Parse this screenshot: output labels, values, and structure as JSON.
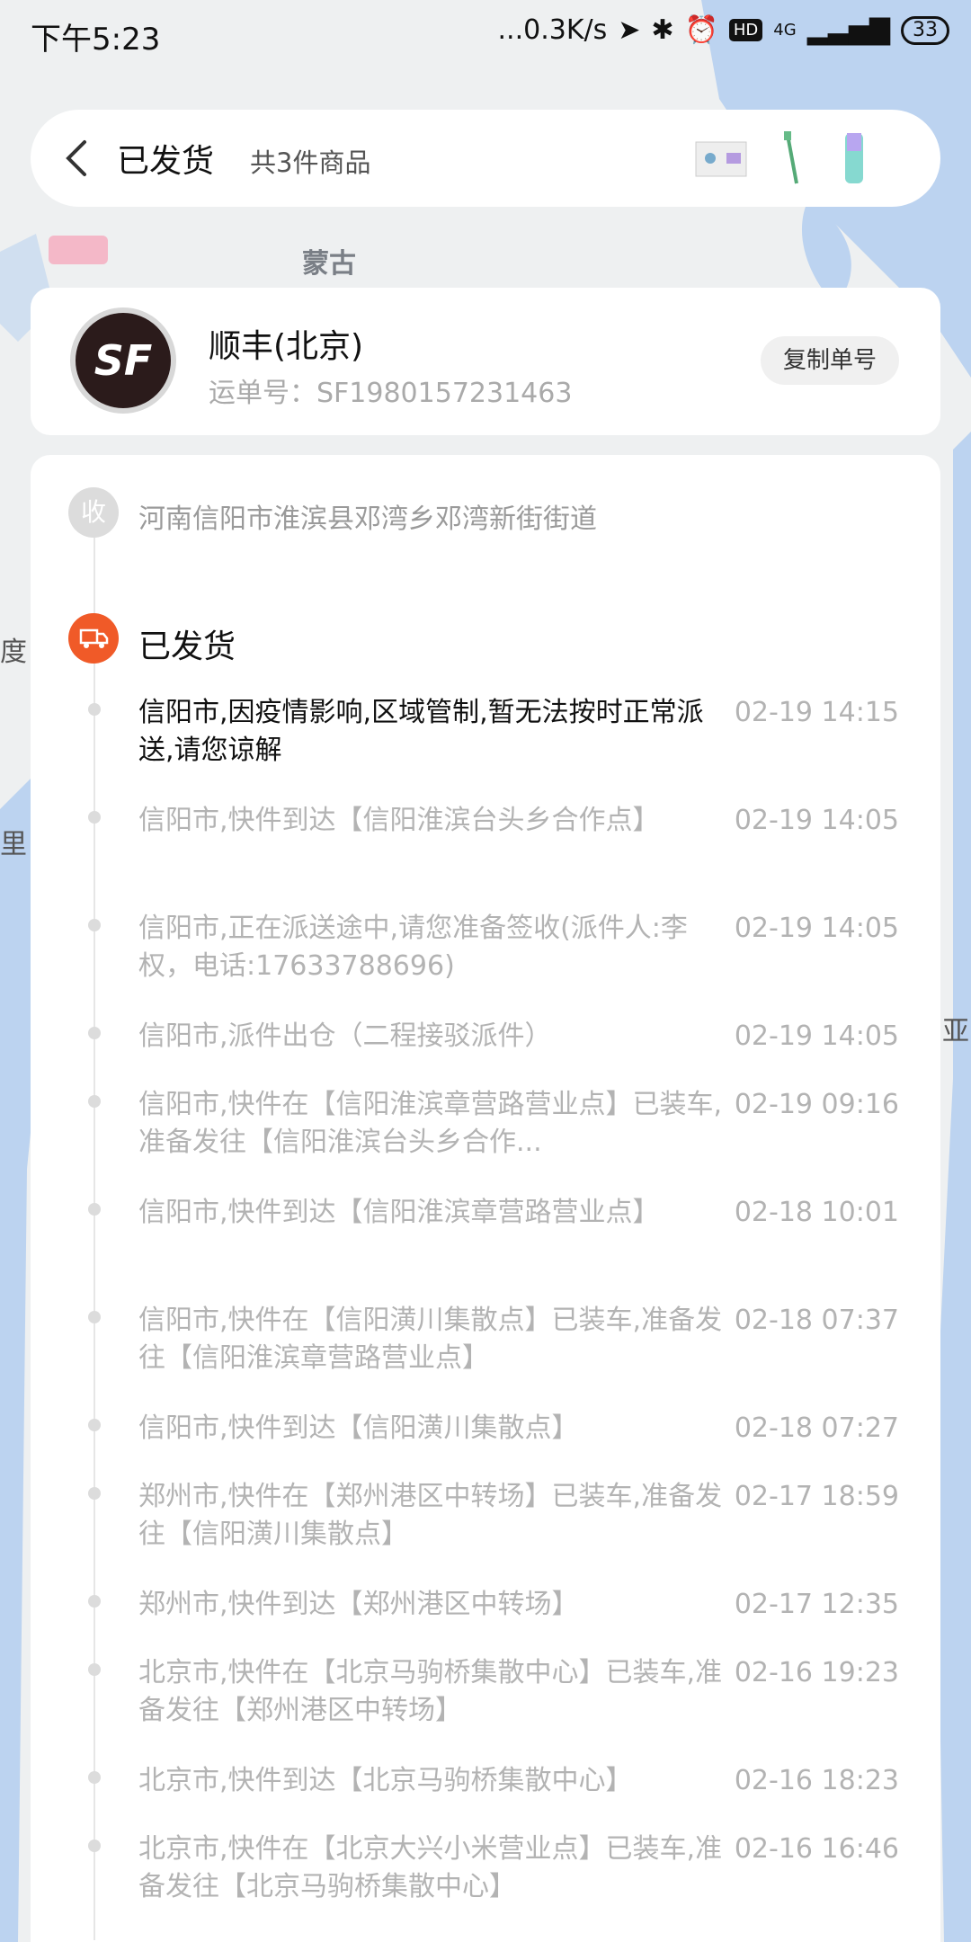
{
  "status_bar": {
    "time": "下午5:23",
    "network_speed": "...0.3K/s",
    "net_type": "4G",
    "hd": "HD",
    "battery": "33"
  },
  "map": {
    "labels": [
      "蒙古",
      "度",
      "亚",
      "里"
    ]
  },
  "header": {
    "title": "已发货",
    "item_count": "共3件商品"
  },
  "courier": {
    "name": "顺丰(北京)",
    "waybill": "运单号：SF1980157231463",
    "copy_label": "复制单号",
    "logo_text": "SF"
  },
  "timeline": {
    "receive_badge": "收",
    "receive_address": "河南信阳市淮滨县邓湾乡邓湾新街街道",
    "shipped_label": "已发货",
    "events": [
      {
        "text": "信阳市,因疫情影响,区域管制,暂无法按时正常派送,请您谅解",
        "time": "02-19 14:15"
      },
      {
        "text": "信阳市,快件到达【信阳淮滨台头乡合作点】",
        "time": "02-19 14:05"
      },
      {
        "text": "信阳市,正在派送途中,请您准备签收(派件人:李权，电话:17633788696)",
        "time": "02-19 14:05"
      },
      {
        "text": "信阳市,派件出仓（二程接驳派件）",
        "time": "02-19 14:05"
      },
      {
        "text": "信阳市,快件在【信阳淮滨章营路营业点】已装车,准备发往【信阳淮滨台头乡合作...",
        "time": "02-19 09:16"
      },
      {
        "text": "信阳市,快件到达【信阳淮滨章营路营业点】",
        "time": "02-18 10:01"
      },
      {
        "text": "信阳市,快件在【信阳潢川集散点】已装车,准备发往【信阳淮滨章营路营业点】",
        "time": "02-18 07:37"
      },
      {
        "text": "信阳市,快件到达【信阳潢川集散点】",
        "time": "02-18 07:27"
      },
      {
        "text": "郑州市,快件在【郑州港区中转场】已装车,准备发往【信阳潢川集散点】",
        "time": "02-17 18:59"
      },
      {
        "text": "郑州市,快件到达【郑州港区中转场】",
        "time": "02-17 12:35"
      },
      {
        "text": "北京市,快件在【北京马驹桥集散中心】已装车,准备发往【郑州港区中转场】",
        "time": "02-16 19:23"
      },
      {
        "text": "北京市,快件到达【北京马驹桥集散中心】",
        "time": "02-16 18:23"
      },
      {
        "text": "北京市,快件在【北京大兴小米营业点】已装车,准备发往【北京马驹桥集散中心】",
        "time": "02-16 16:46"
      }
    ]
  },
  "colors": {
    "accent": "#f05a28",
    "water": "#bcd3f0",
    "land": "#eef0f1"
  }
}
